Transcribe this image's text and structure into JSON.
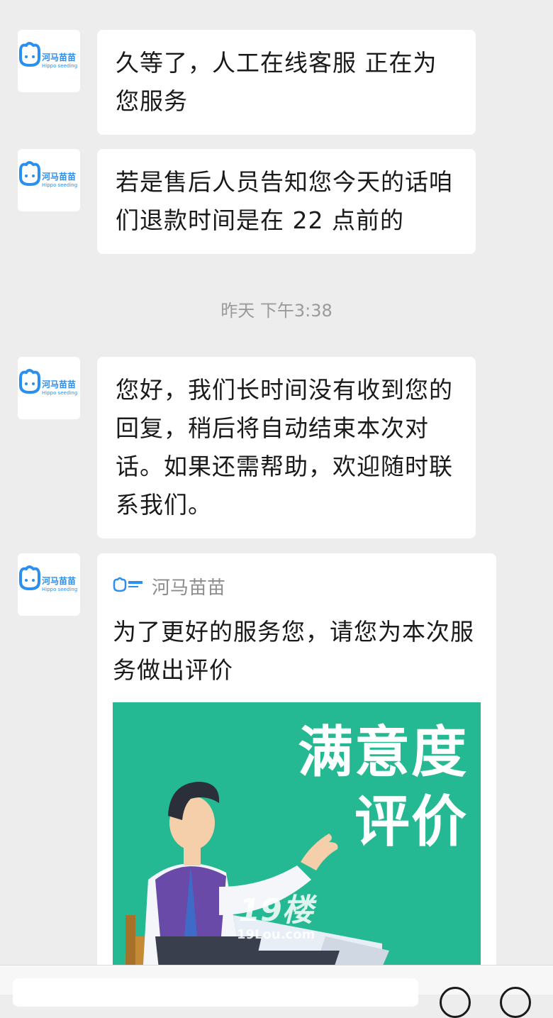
{
  "brand": {
    "name_cn": "河马苗苗",
    "name_en": "Hippo seeding",
    "color": "#2b8ff0"
  },
  "messages": [
    {
      "text": "久等了，人工在线客服 正在为您服务"
    },
    {
      "text": "若是售后人员告知您今天的话咱们退款时间是在 22 点前的"
    },
    {
      "text": "您好，我们长时间没有收到您的回复，稍后将自动结束本次对话。如果还需帮助，欢迎随时联系我们。"
    }
  ],
  "timestamp": "昨天 下午3:38",
  "card": {
    "brand": "河马苗苗",
    "text": "为了更好的服务您，请您为本次服务做出评价",
    "banner_title_line1": "满意度",
    "banner_title_line2": "评价",
    "banner_color": "#24b992"
  },
  "watermark": {
    "big": "19楼",
    "small": "19Lou.com"
  },
  "bottom_bar": {
    "buttons": [
      "emoji-button",
      "more-button"
    ]
  }
}
